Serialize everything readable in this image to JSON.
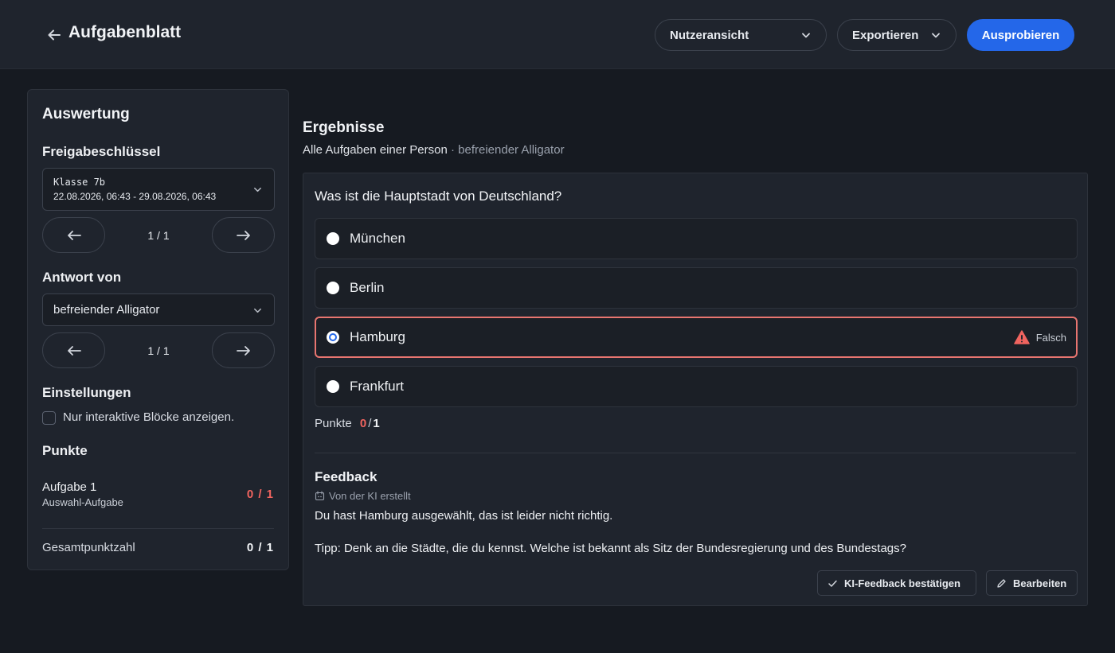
{
  "header": {
    "title": "Aufgabenblatt",
    "view_select": "Nutzeransicht",
    "export_label": "Exportieren",
    "try_label": "Ausprobieren",
    "accent_color": "#2467e9"
  },
  "sidebar": {
    "title": "Auswertung",
    "key_section": {
      "heading": "Freigabeschlüssel",
      "selected_name": "Klasse 7b",
      "selected_range": "22.08.2026, 06:43 - 29.08.2026, 06:43",
      "pager": "1 / 1"
    },
    "answer_section": {
      "heading": "Antwort von",
      "selected": "befreiender Alligator",
      "pager": "1 / 1"
    },
    "settings": {
      "heading": "Einstellungen",
      "only_interactive_label": "Nur interaktive Blöcke anzeigen.",
      "only_interactive_checked": false
    },
    "points": {
      "heading": "Punkte",
      "task_name": "Aufgabe 1",
      "task_type": "Auswahl-Aufgabe",
      "task_score": "0 / 1",
      "total_label": "Gesamtpunktzahl",
      "total_score": "0 / 1"
    }
  },
  "main": {
    "title": "Ergebnisse",
    "subtitle_scope": "Alle Aufgaben einer Person",
    "subtitle_separator": " · ",
    "subtitle_person": "befreiender Alligator",
    "question": "Was ist die Hauptstadt von Deutschland?",
    "options": [
      {
        "label": "München",
        "selected": false
      },
      {
        "label": "Berlin",
        "selected": false
      },
      {
        "label": "Hamburg",
        "selected": true,
        "status": "Falsch"
      },
      {
        "label": "Frankfurt",
        "selected": false
      }
    ],
    "points_label": "Punkte",
    "points_achieved": "0",
    "points_separator": "/",
    "points_max": "1",
    "feedback": {
      "title": "Feedback",
      "meta": "Von der KI erstellt",
      "line1": "Du hast Hamburg ausgewählt, das ist leider nicht richtig.",
      "line2": "Tipp: Denk an die Städte, die du kennst. Welche ist bekannt als Sitz der Bundesregierung und des Bundestags?",
      "confirm_label": "KI-Feedback bestätigen",
      "edit_label": "Bearbeiten"
    },
    "error_color": "#f0645f"
  }
}
